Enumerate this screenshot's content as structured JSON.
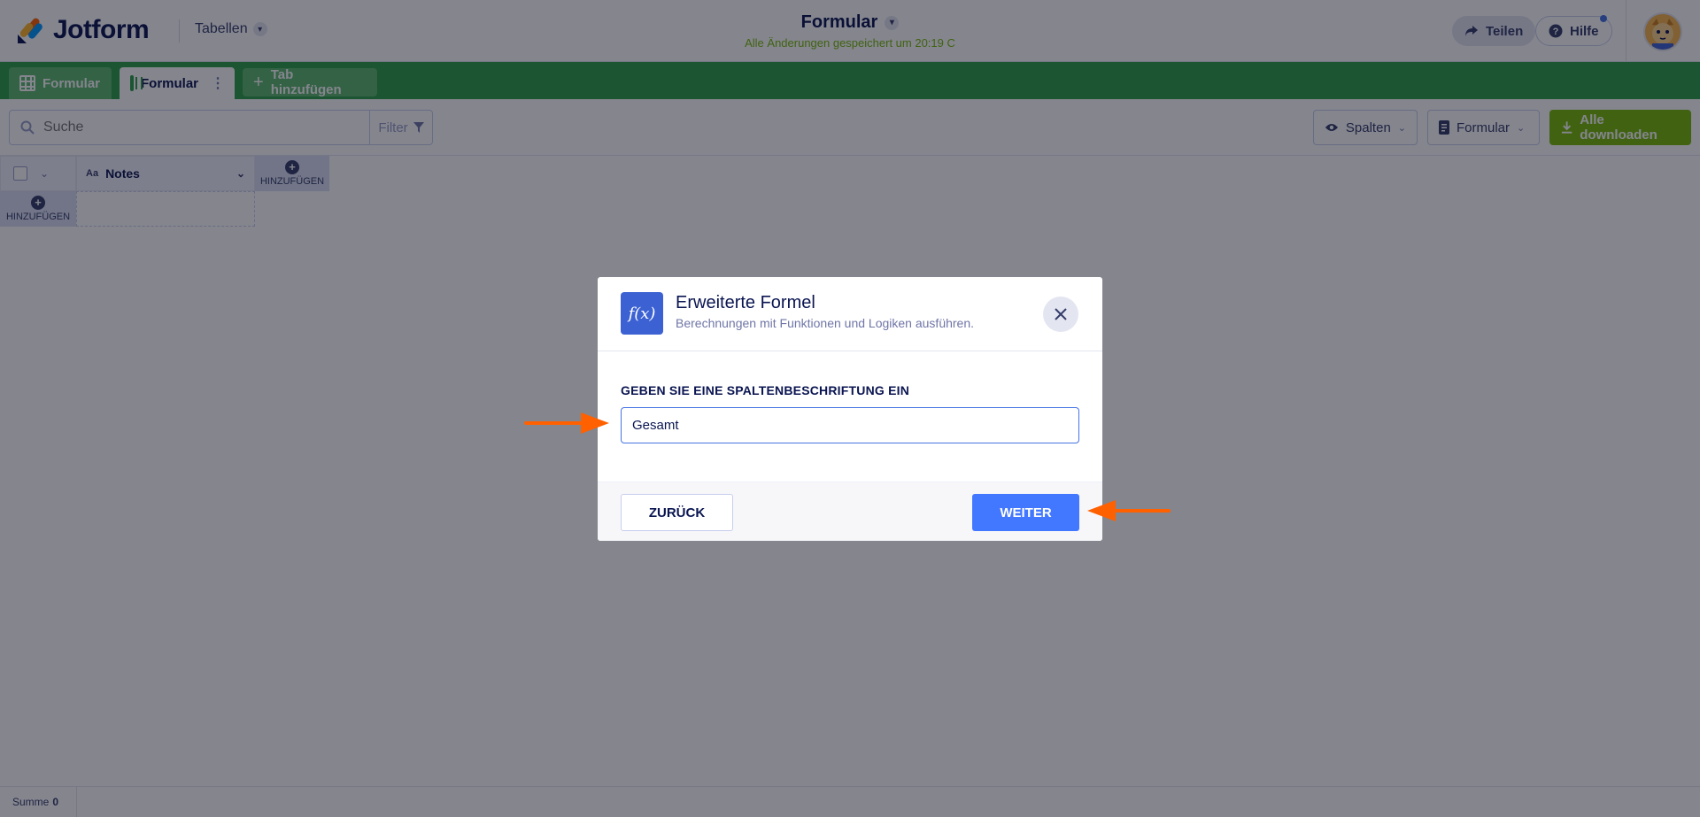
{
  "header": {
    "brand": "Jotform",
    "tables_label": "Tabellen",
    "form_title": "Formular",
    "save_status": "Alle Änderungen gespeichert um 20:19 C",
    "share_label": "Teilen",
    "help_label": "Hilfe"
  },
  "tabs": [
    {
      "label": "Formular"
    },
    {
      "label": "Formular"
    },
    {
      "label": "Tab hinzufügen"
    }
  ],
  "toolbar": {
    "search_placeholder": "Suche",
    "filter_label": "Filter",
    "columns_label": "Spalten",
    "form_label": "Formular",
    "download_label": "Alle downloaden"
  },
  "grid": {
    "column_header": "Notes",
    "column_type_glyph": "Aa",
    "add_column_label": "HINZUFÜGEN",
    "add_row_label": "HINZUFÜGEN"
  },
  "footer": {
    "sum_label": "Summe",
    "sum_value": "0"
  },
  "modal": {
    "icon_text": "f(x)",
    "title": "Erweiterte Formel",
    "subtitle": "Berechnungen mit Funktionen und Logiken ausführen.",
    "field_label": "GEBEN SIE EINE SPALTENBESCHRIFTUNG EIN",
    "field_value": "Gesamt",
    "back_label": "ZURÜCK",
    "next_label": "WEITER"
  },
  "colors": {
    "accent_green": "#2c9e48",
    "download_green": "#78bb07",
    "primary_blue": "#4277ff",
    "annotation_orange": "#ff6100"
  }
}
